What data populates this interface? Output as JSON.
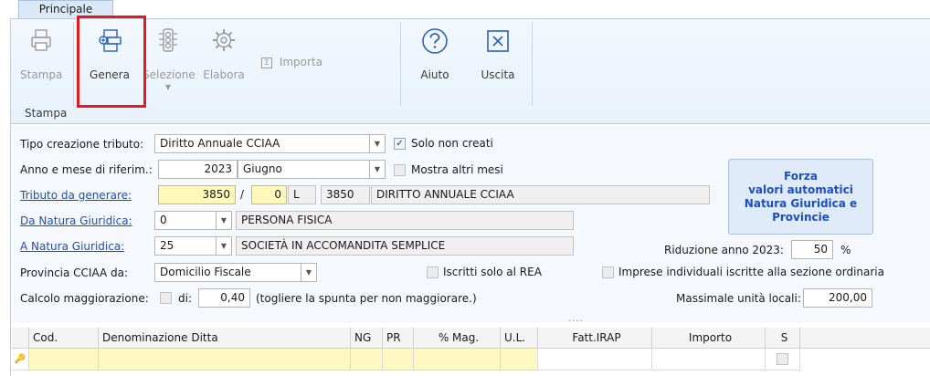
{
  "ribbon": {
    "tab_label": "Principale",
    "buttons": {
      "stampa": "Stampa",
      "genera": "Genera",
      "selezione": "Selezione",
      "elabora": "Elabora",
      "importa": "Importa",
      "aiuto": "Aiuto",
      "uscita": "Uscita"
    },
    "group_label": "Stampa"
  },
  "form": {
    "tipo_creazione": {
      "label": "Tipo creazione tributo:",
      "value": "Diritto Annuale CCIAA"
    },
    "solo_non_creati": {
      "label": "Solo non creati",
      "checked": true
    },
    "anno_mese": {
      "label": "Anno e mese di riferim.:",
      "year": "2023",
      "month": "Giugno"
    },
    "mostra_altri_mesi": {
      "label": "Mostra altri mesi",
      "checked": false
    },
    "tributo": {
      "label": "Tributo da generare:",
      "code": "3850",
      "separator": "/",
      "sub": "0",
      "letter": "L",
      "code2": "3850",
      "description": "DIRITTO ANNUALE CCIAA"
    },
    "da_natura": {
      "label": "Da Natura Giuridica:",
      "value": "0",
      "description": "PERSONA FISICA"
    },
    "a_natura": {
      "label": "A Natura Giuridica:",
      "value": "25",
      "description": "SOCIETÀ IN ACCOMANDITA SEMPLICE"
    },
    "provincia": {
      "label": "Provincia CCIAA da:",
      "value": "Domicilio Fiscale"
    },
    "iscritti_rea": {
      "label": "Iscritti solo al REA",
      "checked": false
    },
    "imprese_individuali": {
      "label": "Imprese individuali iscritte alla sezione ordinaria",
      "checked": false
    },
    "maggiorazione": {
      "label": "Calcolo maggiorazione:",
      "di_label": "di:",
      "value": "0,40",
      "hint": "(togliere la spunta per non maggiorare.)"
    },
    "riduzione": {
      "label": "Riduzione anno 2023:",
      "value": "50",
      "unit": "%"
    },
    "massimale": {
      "label": "Massimale unità locali:",
      "value": "200,00"
    },
    "forza_button": [
      "Forza",
      "valori automatici",
      "Natura Giuridica  e",
      "Provincie"
    ]
  },
  "grid": {
    "dots": "....",
    "columns": [
      "Cod.",
      "Denominazione Ditta",
      "NG",
      "PR",
      "% Mag.",
      "U.L.",
      "Fatt.IRAP",
      "Importo",
      "S"
    ]
  },
  "colors": {
    "highlight": "#e01b22",
    "link": "#1a4fbf",
    "required_field": "#fff8b8",
    "forza_text": "#1d4fc4"
  }
}
